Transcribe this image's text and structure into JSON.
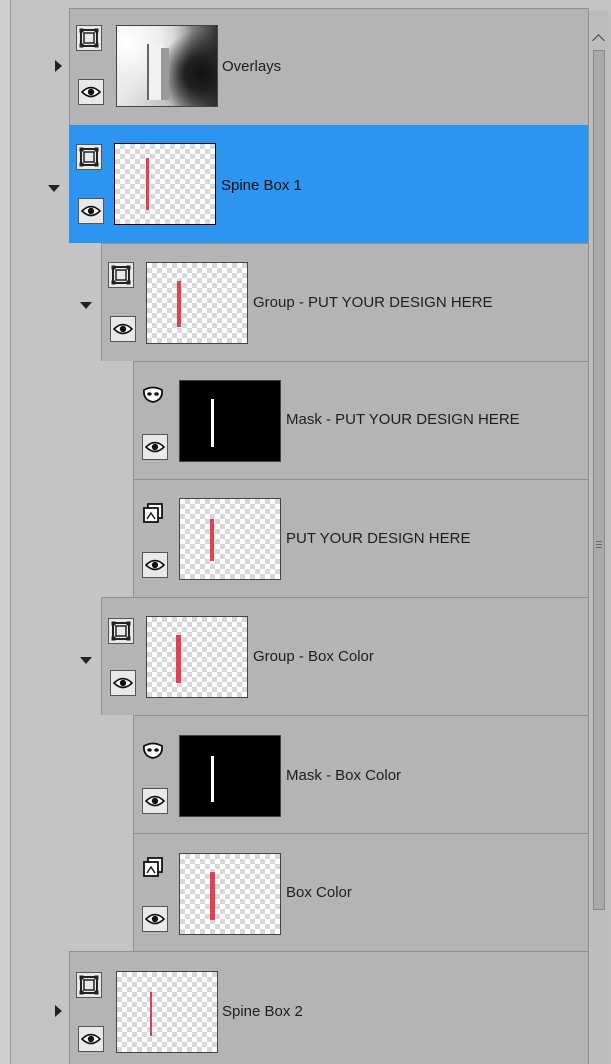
{
  "layers_panel": {
    "scrollbar_visible": true,
    "selection_color": "#2d95ef",
    "layers": [
      {
        "name": "Overlays",
        "type": "group",
        "expand_state": "collapsed",
        "thumb": "photo",
        "selected": false,
        "visible": true
      },
      {
        "name": "Spine Box 1",
        "type": "group",
        "expand_state": "expanded",
        "thumb": "transparent-red-strip",
        "selected": true,
        "visible": true
      },
      {
        "name": "Group - PUT YOUR DESIGN HERE",
        "type": "group",
        "expand_state": "expanded",
        "thumb": "transparent-red-strip",
        "selected": false,
        "visible": true
      },
      {
        "name": "Mask - PUT YOUR DESIGN HERE",
        "type": "mask",
        "expand_state": "none",
        "thumb": "black-white-strip",
        "selected": false,
        "visible": true
      },
      {
        "name": "PUT YOUR DESIGN HERE",
        "type": "raster",
        "expand_state": "none",
        "thumb": "transparent-red-strip",
        "selected": false,
        "visible": true
      },
      {
        "name": "Group - Box Color",
        "type": "group",
        "expand_state": "expanded",
        "thumb": "transparent-red-strip",
        "selected": false,
        "visible": true
      },
      {
        "name": "Mask - Box Color",
        "type": "mask",
        "expand_state": "none",
        "thumb": "black-white-strip",
        "selected": false,
        "visible": true
      },
      {
        "name": "Box Color",
        "type": "raster",
        "expand_state": "none",
        "thumb": "transparent-red-strip",
        "selected": false,
        "visible": true
      },
      {
        "name": "Spine Box 2",
        "type": "group",
        "expand_state": "collapsed",
        "thumb": "transparent-red-strip",
        "selected": false,
        "visible": true
      }
    ]
  }
}
